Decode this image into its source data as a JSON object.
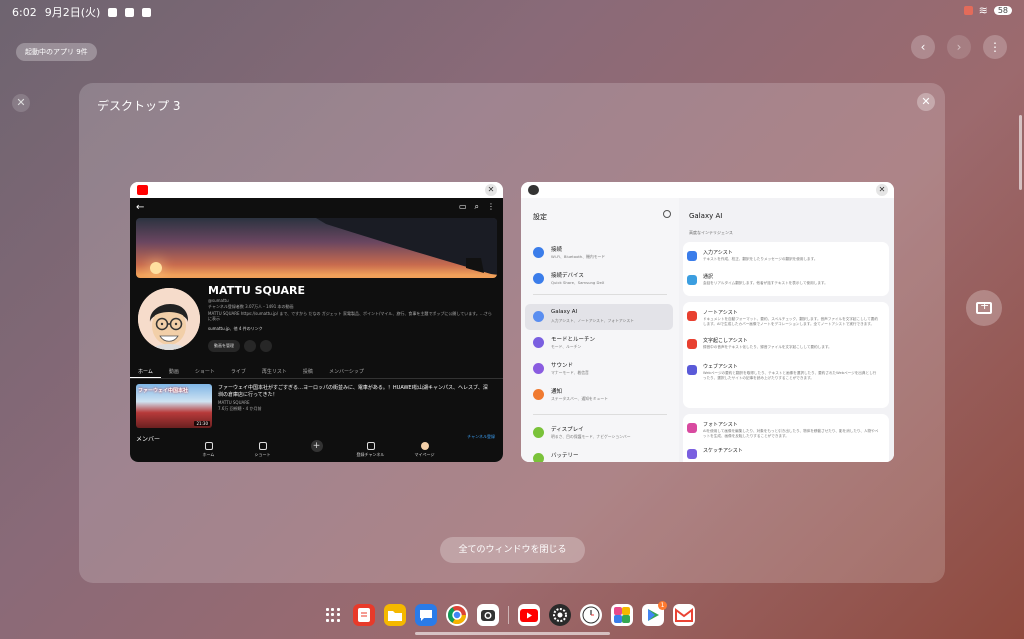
{
  "status": {
    "time": "6:02",
    "date": "9月2日(火)",
    "battery": "58"
  },
  "running_apps_label": "起動中のアプリ 9件",
  "desktop": {
    "title": "デスクトップ 3",
    "close_all": "全てのウィンドウを閉じる"
  },
  "youtube": {
    "channel_name": "MATTU SQUARE",
    "handle": "@sumattu",
    "stats": "チャンネル登録者数 3.07万人・1491 本の動画",
    "description": "MATTU SQUARE https://sumattu.jp/ まで、ですから だなの ガジェット 家電製品、ポイント/マイル、旅行、食事を主題でポップに公開しています。…さらに表示",
    "link": "sumattu.jp、他 4 件のリンク",
    "manage_button": "動画を管理",
    "tabs": [
      "ホーム",
      "動画",
      "ショート",
      "ライブ",
      "再生リスト",
      "投稿",
      "メンバーシップ"
    ],
    "video": {
      "title": "ファーウェイ中国本社がすごすぎる…ヨーロッパの街並みに、電車がある。！HUAWEI松山湖キャンパス、ヘレスブ、深圳の倉庫店に行ってきた！",
      "channel": "MATTU SQUARE",
      "meta": "7.6万 回視聴・4 か月前",
      "thumb_caption": "ファーウェイ中国本社",
      "duration": "21:30"
    },
    "members_label": "メンバー",
    "join_label": "チャンネル登録",
    "bottom_nav": [
      "ホーム",
      "ショート",
      "",
      "登録チャンネル",
      "マイページ"
    ]
  },
  "settings": {
    "header": "設定",
    "items": [
      {
        "title": "接続",
        "sub": "Wi-Fi、Bluetooth、機内モード",
        "color": "#3b7dea"
      },
      {
        "title": "接続デバイス",
        "sub": "Quick Share、Samsung DeX",
        "color": "#3b7dea"
      },
      {
        "title": "Galaxy AI",
        "sub": "入力アシスト、ノートアシスト、フォトアシスト",
        "color": "#5a8ef0"
      },
      {
        "title": "モードとルーチン",
        "sub": "モード、ルーチン",
        "color": "#7a5fe0"
      },
      {
        "title": "サウンド",
        "sub": "マナーモード、着信音",
        "color": "#8a5ce0"
      },
      {
        "title": "通知",
        "sub": "ステータスバー、通知をミュート",
        "color": "#f07a30"
      },
      {
        "title": "ディスプレイ",
        "sub": "明るさ、目の保護モード、ナビゲーションバー",
        "color": "#7ac23a"
      },
      {
        "title": "バッテリー",
        "sub": "",
        "color": "#7ac23a"
      }
    ]
  },
  "galaxy_ai": {
    "title": "Galaxy AI",
    "subtitle": "高度なインテリジェンス",
    "features": [
      {
        "title": "入力アシスト",
        "sub": "テキストを作成、校正、翻訳をしたりメッセージの翻訳を使用します。",
        "color": "#3b7dea"
      },
      {
        "title": "通訳",
        "sub": "会話をリアルタイム翻訳します。他者が話すテキストを表示して使用します。",
        "color": "#3b9ee0"
      },
      {
        "title": "ノートアシスト",
        "sub": "ドキュメントを自動フォーマット、要約、スペルチェック、翻訳します。音声ファイルを文字起こしして要約します。AIで生成したカバー画像でノートをデコレーションします。全てノートアシストで実行できます。",
        "color": "#e84030"
      },
      {
        "title": "文字起こしアシスト",
        "sub": "録音中の音声をテキスト化したり、録音ファイルを文字起こしして要約します。",
        "color": "#e84030"
      },
      {
        "title": "ウェブアシスト",
        "sub": "Webページの要約と翻訳を取得したり、テキストと画像を選択したり、要約されたWebページを出典とし行ったり、選択したサイトの記事を読み上げたりすることができます。",
        "color": "#5a5ad8"
      },
      {
        "title": "フォトアシスト",
        "sub": "AIを使用して画像を編集したり、対象をもっと引き出したり、物体を移動させたり、影を消したり、人物やペットを生成、画像を反転したりすることができます。",
        "color": "#d84aa0"
      },
      {
        "title": "スケッチアシスト",
        "sub": "",
        "color": "#7a5fe0"
      }
    ]
  },
  "dock": [
    {
      "name": "app-drawer",
      "color": "transparent"
    },
    {
      "name": "samsung-notes-icon",
      "color": "#e83a2a"
    },
    {
      "name": "my-files-icon",
      "color": "#f5b800"
    },
    {
      "name": "messages-icon",
      "color": "#2a7be8"
    },
    {
      "name": "chrome-icon",
      "color": "#ffffff"
    },
    {
      "name": "camera-icon",
      "color": "#ffffff"
    },
    {
      "name": "youtube-icon",
      "color": "#ffffff"
    },
    {
      "name": "settings-icon",
      "color": "#2a2a2a"
    },
    {
      "name": "clock-icon",
      "color": "#ffffff"
    },
    {
      "name": "gallery-icon",
      "color": "#ffffff"
    },
    {
      "name": "play-store-icon",
      "color": "#ffffff"
    },
    {
      "name": "gmail-icon",
      "color": "#ffffff"
    }
  ],
  "play_store_badge": "1"
}
